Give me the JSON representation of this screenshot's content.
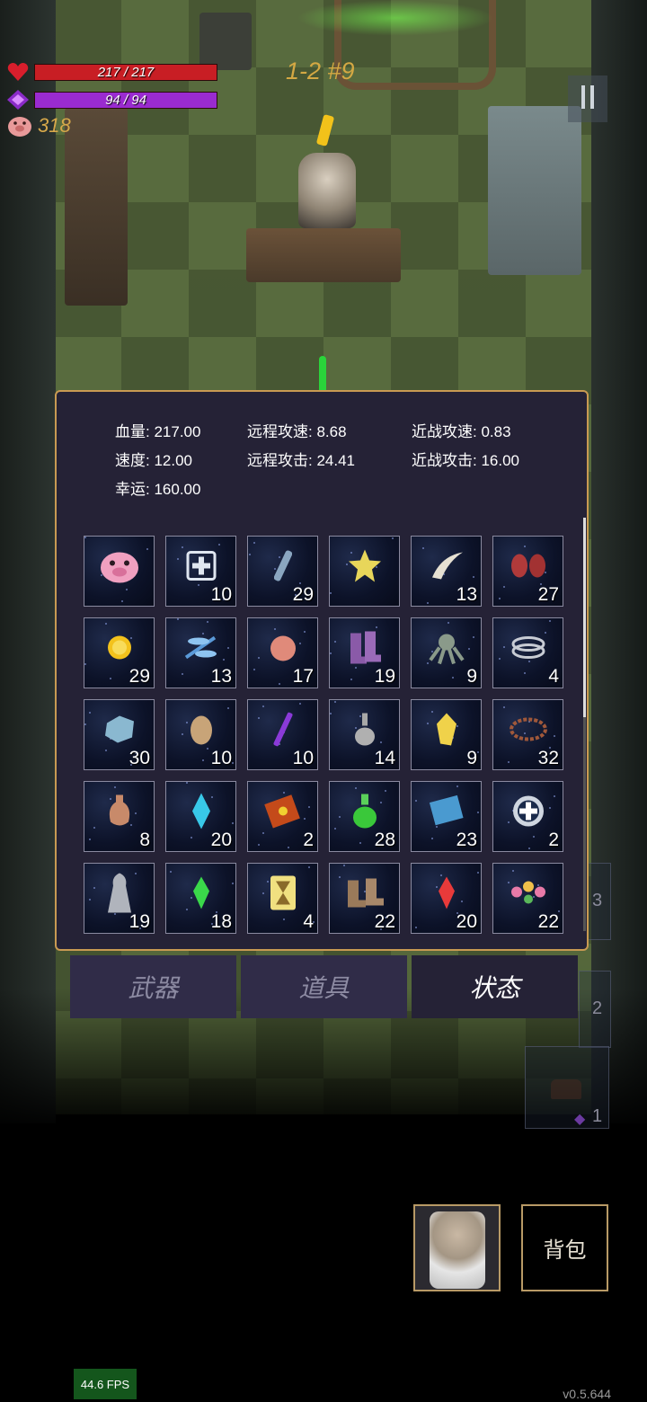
{
  "hud": {
    "hp_text": "217 / 217",
    "hp_fraction": 1.0,
    "hp_color": "#c81e24",
    "mp_text": "94 / 94",
    "mp_fraction": 1.0,
    "mp_color": "#9a2bd0",
    "coins": "318",
    "level_label": "1-2 #9",
    "pause_icon": "pause-icon"
  },
  "stats": {
    "rows": [
      {
        "label": "血量:",
        "value": "217.00"
      },
      {
        "label": "远程攻速:",
        "value": "8.68"
      },
      {
        "label": "近战攻速:",
        "value": "0.83"
      },
      {
        "label": "速度:",
        "value": "12.00"
      },
      {
        "label": "远程攻击:",
        "value": "24.41"
      },
      {
        "label": "近战攻击:",
        "value": "16.00"
      },
      {
        "label": "幸运:",
        "value": "160.00"
      }
    ]
  },
  "inventory": [
    {
      "icon": "piggy-bank-icon",
      "count": ""
    },
    {
      "icon": "medkit-icon",
      "count": "10"
    },
    {
      "icon": "vial-icon",
      "count": "29"
    },
    {
      "icon": "yellow-star-crystal-icon",
      "count": ""
    },
    {
      "icon": "fang-icon",
      "count": "13"
    },
    {
      "icon": "red-gloves-icon",
      "count": "27"
    },
    {
      "icon": "gold-coin-icon",
      "count": "29"
    },
    {
      "icon": "dragonfly-icon",
      "count": "13"
    },
    {
      "icon": "peach-icon",
      "count": "17"
    },
    {
      "icon": "purple-boots-icon",
      "count": "19"
    },
    {
      "icon": "octopus-icon",
      "count": "9"
    },
    {
      "icon": "double-ring-icon",
      "count": "4"
    },
    {
      "icon": "blue-stone-icon",
      "count": "30"
    },
    {
      "icon": "egg-icon",
      "count": "10"
    },
    {
      "icon": "purple-wand-icon",
      "count": "10"
    },
    {
      "icon": "flask-icon",
      "count": "14"
    },
    {
      "icon": "yellow-crystal-icon",
      "count": "9"
    },
    {
      "icon": "thorn-crown-icon",
      "count": "32"
    },
    {
      "icon": "clay-vase-icon",
      "count": "8"
    },
    {
      "icon": "blue-crystal-icon",
      "count": "20"
    },
    {
      "icon": "spell-book-icon",
      "count": "2"
    },
    {
      "icon": "green-potion-icon",
      "count": "28"
    },
    {
      "icon": "blue-book-icon",
      "count": "23"
    },
    {
      "icon": "shield-cross-icon",
      "count": "2"
    },
    {
      "icon": "cloak-figure-icon",
      "count": "19"
    },
    {
      "icon": "green-crystal-icon",
      "count": "18"
    },
    {
      "icon": "hourglass-card-icon",
      "count": "4"
    },
    {
      "icon": "leather-boots-icon",
      "count": "22"
    },
    {
      "icon": "red-crystal-icon",
      "count": "20"
    },
    {
      "icon": "flower-wreath-icon",
      "count": "22"
    }
  ],
  "tabs": [
    {
      "label": "武器",
      "active": false
    },
    {
      "label": "道具",
      "active": false
    },
    {
      "label": "状态",
      "active": true
    }
  ],
  "side_counts": {
    "a": "3",
    "b": "2",
    "c": "1"
  },
  "bag_label": "背包",
  "fps": "44.6 FPS",
  "version": "v0.5.644",
  "colors": {
    "panel_bg": "#252236",
    "panel_border": "#c89a52",
    "coin": "#d6a84a"
  }
}
